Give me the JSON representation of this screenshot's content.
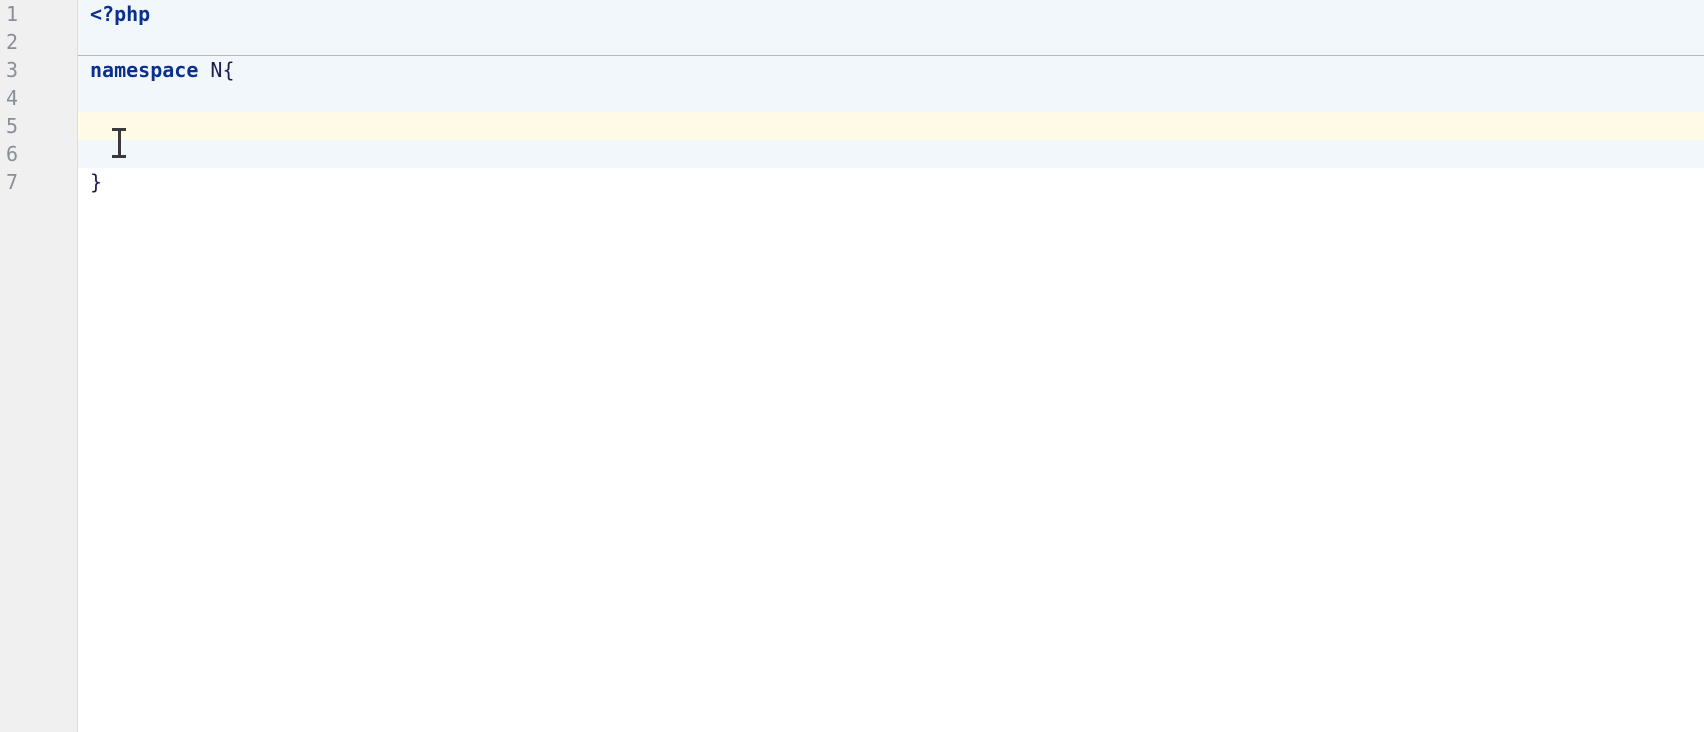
{
  "gutter": {
    "numbers": [
      "1",
      "2",
      "3",
      "4",
      "5",
      "6",
      "7"
    ]
  },
  "code": {
    "line1": {
      "t1": "<?php"
    },
    "line3": {
      "t1": "namespace",
      "t2": " ",
      "t3": "N",
      "t4": "{"
    },
    "line7": {
      "t1": "}"
    }
  }
}
